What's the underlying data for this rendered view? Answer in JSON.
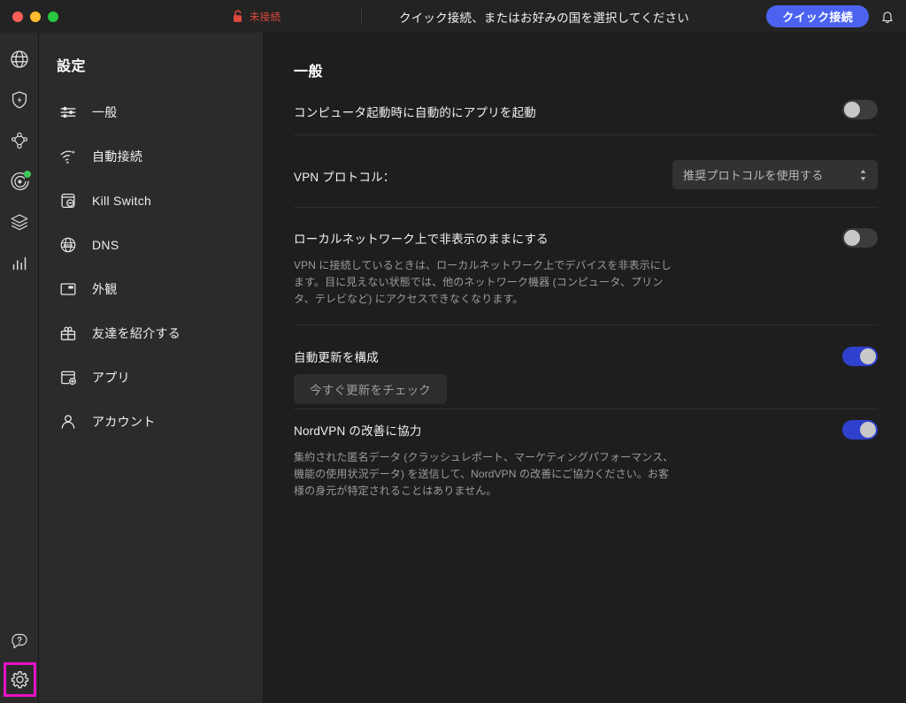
{
  "titlebar": {
    "window_controls": [
      "close",
      "minimize",
      "zoom"
    ],
    "connection_status": "未接続",
    "lock_icon": "unlock-icon",
    "status_color": "#e0483c",
    "hint": "クイック接続、またはお好みの国を選択してください",
    "quick_connect_label": "クイック接続",
    "quick_connect_color": "#4b63f0",
    "bell_icon": "bell-icon"
  },
  "rail": {
    "items": [
      {
        "name": "vpn-globe",
        "icon": "globe-icon",
        "badge": false
      },
      {
        "name": "threat-protection",
        "icon": "shield-bolt-icon",
        "badge": false
      },
      {
        "name": "meshnet",
        "icon": "meshnet-icon",
        "badge": false
      },
      {
        "name": "dark-web-monitor",
        "icon": "radar-icon",
        "badge": true,
        "badge_color": "#3ec65a"
      },
      {
        "name": "file-share",
        "icon": "layers-icon",
        "badge": false
      },
      {
        "name": "statistics",
        "icon": "bar-chart-icon",
        "badge": false
      }
    ],
    "bottom": [
      {
        "name": "help",
        "icon": "help-bubble-icon"
      },
      {
        "name": "settings",
        "icon": "gear-icon",
        "highlighted": true,
        "highlight_color": "#e612c8"
      }
    ]
  },
  "sidebar": {
    "title": "設定",
    "items": [
      {
        "label": "一般",
        "icon": "sliders-icon"
      },
      {
        "label": "自動接続",
        "icon": "wifi-sparkle-icon"
      },
      {
        "label": "Kill Switch",
        "icon": "kill-switch-icon"
      },
      {
        "label": "DNS",
        "icon": "dns-globe-icon"
      },
      {
        "label": "外観",
        "icon": "appearance-window-icon"
      },
      {
        "label": "友達を紹介する",
        "icon": "gift-icon"
      },
      {
        "label": "アプリ",
        "icon": "app-add-icon"
      },
      {
        "label": "アカウント",
        "icon": "person-icon"
      }
    ]
  },
  "main": {
    "title": "一般",
    "launch_on_startup": {
      "label": "コンピュータ起動時に自動的にアプリを起動",
      "toggle_state": "off"
    },
    "vpn_protocol": {
      "label": "VPN プロトコル：",
      "selected": "推奨プロトコルを使用する"
    },
    "invisible_on_lan": {
      "label": "ローカルネットワーク上で非表示のままにする",
      "description": "VPN に接続しているときは、ローカルネットワーク上でデバイスを非表示にします。目に見えない状態では、他のネットワーク機器 (コンピュータ、プリンタ、テレビなど) にアクセスできなくなります。",
      "toggle_state": "off"
    },
    "auto_update": {
      "label": "自動更新を構成",
      "button_label": "今すぐ更新をチェック",
      "toggle_state": "on"
    },
    "help_improve": {
      "label": "NordVPN の改善に協力",
      "description": "集約された匿名データ (クラッシュレポート、マーケティングパフォーマンス、機能の使用状況データ) を送信して、NordVPN の改善にご協力ください。お客様の身元が特定されることはありません。",
      "toggle_state": "on"
    }
  }
}
